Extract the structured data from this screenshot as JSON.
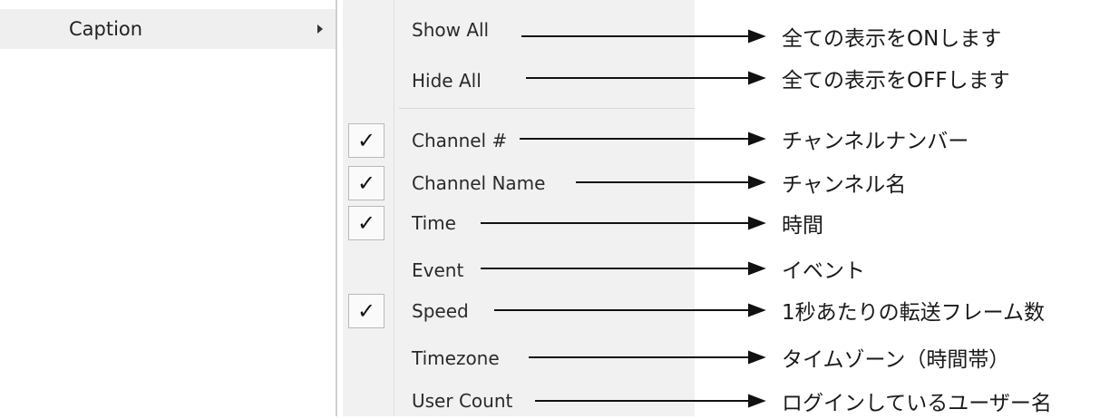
{
  "parent_menu": {
    "caption_label": "Caption"
  },
  "submenu": {
    "items": [
      {
        "label": "Show All",
        "checked": false
      },
      {
        "label": "Hide All",
        "checked": false
      },
      {
        "label": "Channel #",
        "checked": true
      },
      {
        "label": "Channel Name",
        "checked": true
      },
      {
        "label": "Time",
        "checked": true
      },
      {
        "label": "Event",
        "checked": false
      },
      {
        "label": "Speed",
        "checked": true
      },
      {
        "label": "Timezone",
        "checked": false
      },
      {
        "label": "User Count",
        "checked": false
      }
    ],
    "check_mark": "✓"
  },
  "annotations": [
    "全ての表示をONします",
    "全ての表示をOFFします",
    "チャンネルナンバー",
    "チャンネル名",
    "時間",
    "イベント",
    "1秒あたりの転送フレーム数",
    "タイムゾーン（時間帯）",
    "ログインしているユーザー名"
  ]
}
